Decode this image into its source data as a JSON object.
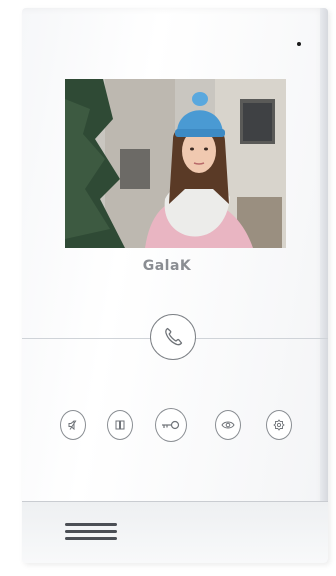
{
  "brand": {
    "name": "GalaK",
    "color": "#8a8d92"
  },
  "screen": {
    "content": "video-feed-visitor"
  },
  "buttons": {
    "call": {
      "icon": "phone-handset-icon"
    },
    "mute": {
      "icon": "speaker-mute-icon"
    },
    "monitor": {
      "icon": "intercom-monitor-icon"
    },
    "unlock": {
      "icon": "key-icon"
    },
    "view": {
      "icon": "eye-icon"
    },
    "settings": {
      "icon": "gear-icon"
    }
  },
  "colors": {
    "device_body": "#f6f7f9",
    "button_outline": "#8a8e93",
    "speaker_grille": "#4b4f55"
  }
}
